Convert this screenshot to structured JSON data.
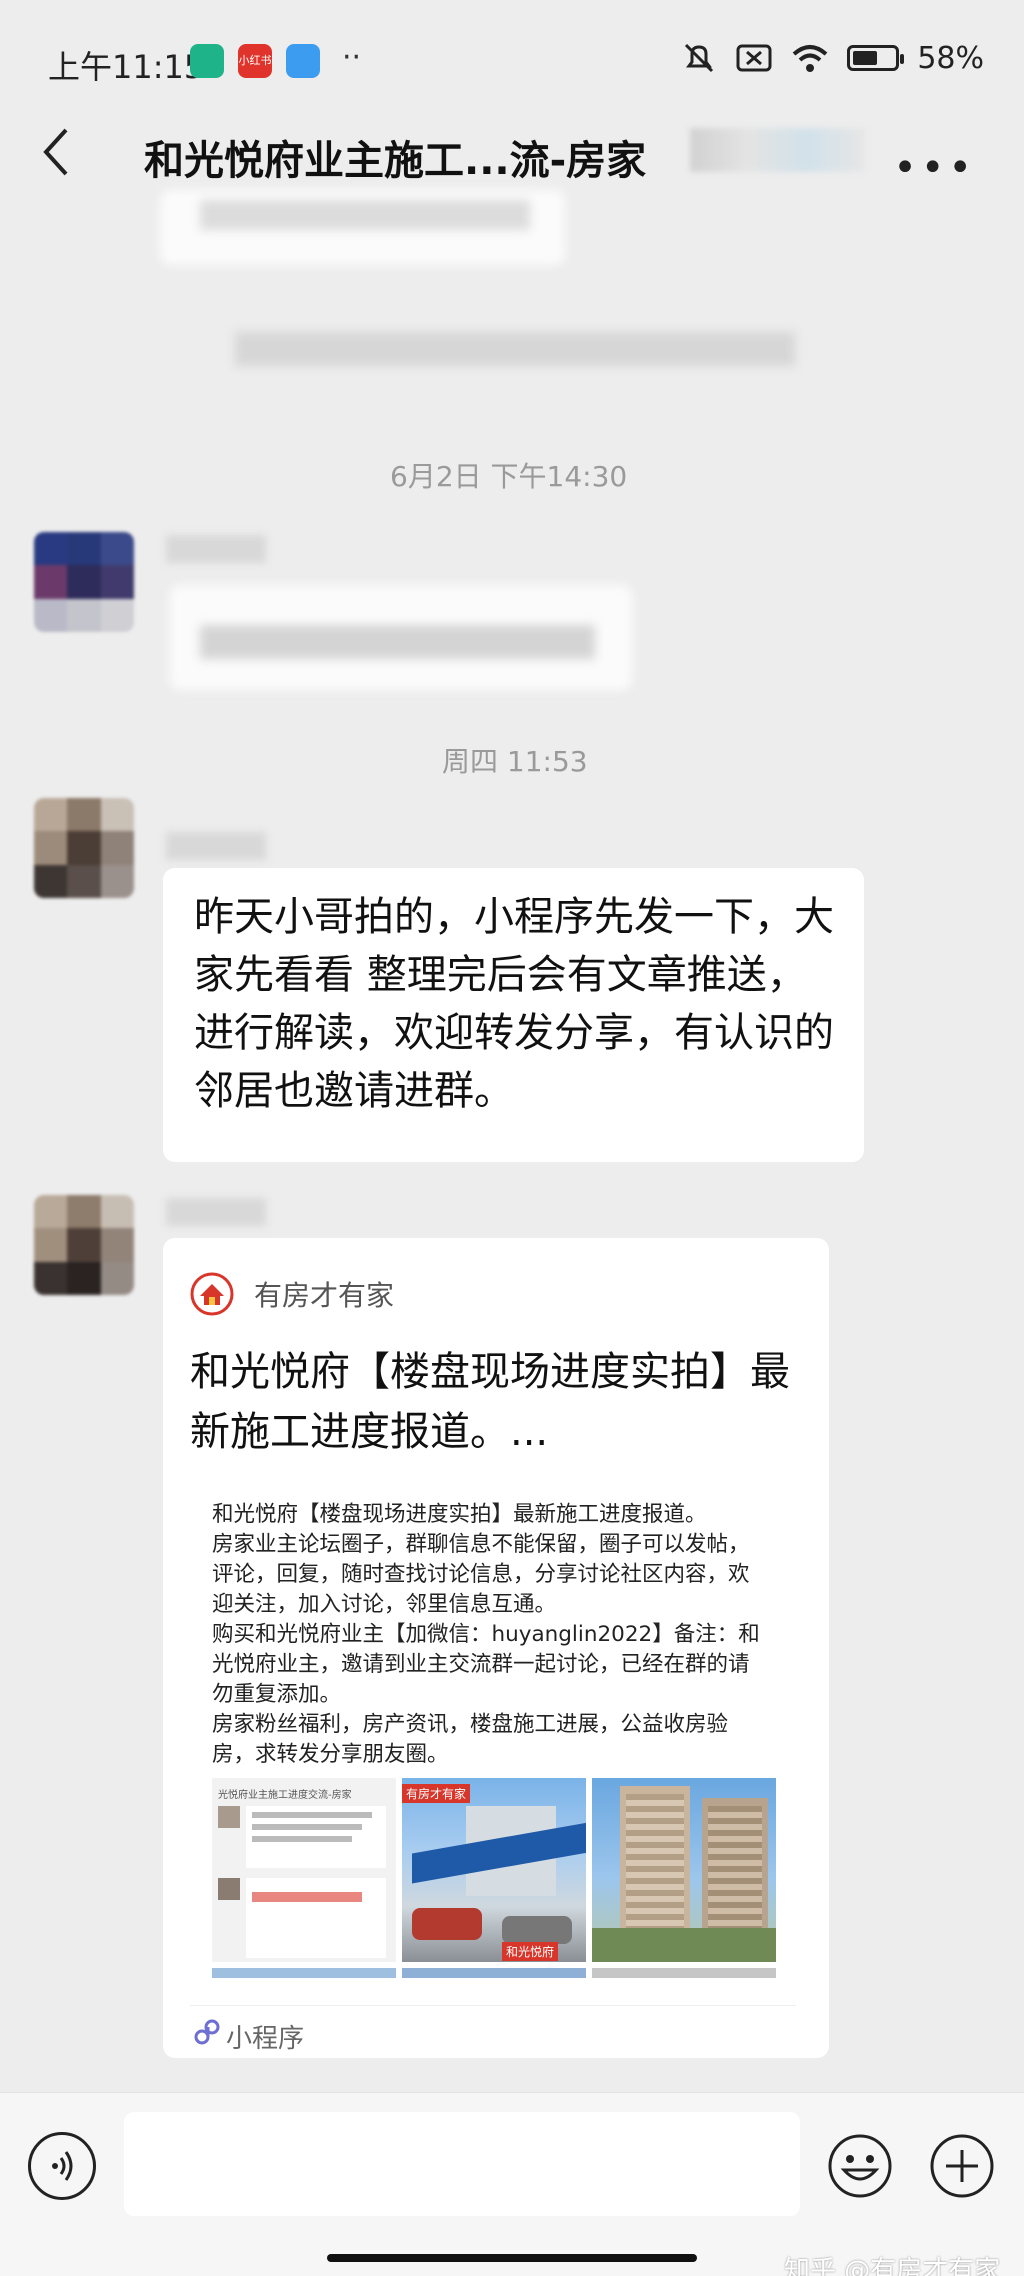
{
  "status_bar": {
    "time": "上午11:15",
    "app_badge_text": "小红书",
    "dots": "··",
    "battery": "58%",
    "battery_level": 0.58
  },
  "nav": {
    "title": "和光悦府业主施工...流-房家"
  },
  "timestamps": {
    "first": "6月2日 下午14:30",
    "second": "周四 11:53"
  },
  "messages": {
    "text_message": "昨天小哥拍的，小程序先发一下，大家先看看 整理完后会有文章推送，进行解读，欢迎转发分享，有认识的邻居也邀请进群。"
  },
  "card": {
    "source": "有房才有家",
    "title": "和光悦府【楼盘现场进度实拍】最新施工进度报道。...",
    "body_lines": [
      "和光悦府【楼盘现场进度实拍】最新施工进度报道。",
      "房家业主论坛圈子，群聊信息不能保留，圈子可以发帖，",
      "评论，回复，随时查找讨论信息，分享讨论社区内容，欢",
      "迎关注，加入讨论，邻里信息互通。",
      "购买和光悦府业主【加微信：huyanglin2022】备注：和",
      "光悦府业主，邀请到业主交流群一起讨论，已经在群的请",
      "勿重复添加。",
      "房家粉丝福利，房产资讯，楼盘施工进展，公益收房验",
      "房，求转发分享朋友圈。"
    ],
    "thumb1_caption": "光悦府业主施工进度交流-房家",
    "thumb2_top": "有房才有家",
    "thumb2_bottom": "和光悦府",
    "mini_program_label": "小程序"
  },
  "input": {
    "placeholder": ""
  },
  "watermark": "知乎 @有房才有家",
  "colors": {
    "background": "#ededed",
    "bubble": "#ffffff",
    "brand_red": "#d9362b"
  }
}
